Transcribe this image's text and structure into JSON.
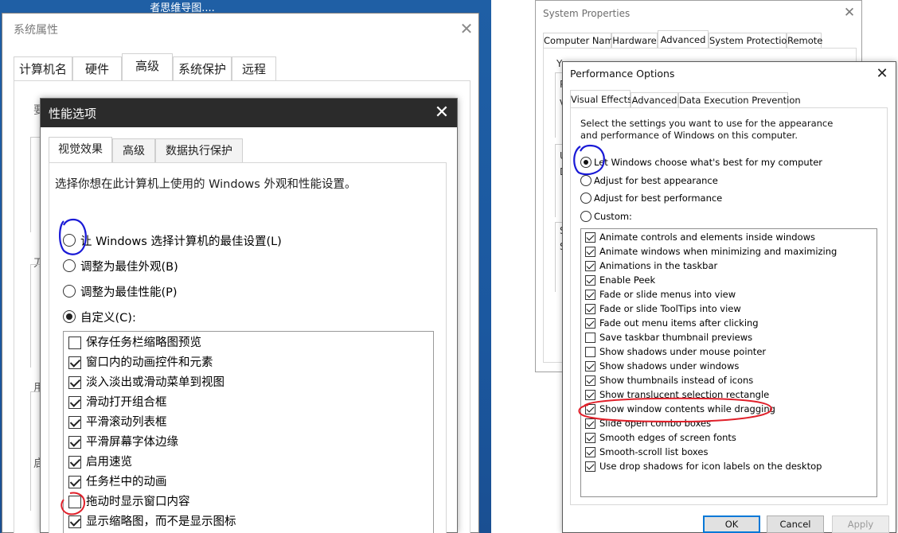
{
  "left": {
    "background_window_title": "者思维导图....",
    "system_properties": {
      "title": "系统属性",
      "tabs": [
        "计算机名",
        "硬件",
        "高级",
        "系统保护",
        "远程"
      ],
      "active_tab": 2,
      "fragments": [
        "要",
        "刀",
        "用",
        "启"
      ]
    },
    "performance_options": {
      "title": "性能选项",
      "tabs": [
        "视觉效果",
        "高级",
        "数据执行保护"
      ],
      "active_tab": 0,
      "description": "选择你想在此计算机上使用的 Windows 外观和性能设置。",
      "radios": [
        {
          "label": "让 Windows 选择计算机的最佳设置(L)",
          "checked": false
        },
        {
          "label": "调整为最佳外观(B)",
          "checked": false
        },
        {
          "label": "调整为最佳性能(P)",
          "checked": false
        },
        {
          "label": "自定义(C):",
          "checked": true
        }
      ],
      "checkbox_items": [
        {
          "label": "保存任务栏缩略图预览",
          "checked": false
        },
        {
          "label": "窗口内的动画控件和元素",
          "checked": true
        },
        {
          "label": "淡入淡出或滑动菜单到视图",
          "checked": true
        },
        {
          "label": "滑动打开组合框",
          "checked": true
        },
        {
          "label": "平滑滚动列表框",
          "checked": true
        },
        {
          "label": "平滑屏幕字体边缘",
          "checked": true
        },
        {
          "label": "启用速览",
          "checked": true
        },
        {
          "label": "任务栏中的动画",
          "checked": true
        },
        {
          "label": "拖动时显示窗口内容",
          "checked": false
        },
        {
          "label": "显示缩略图，而不是显示图标",
          "checked": true
        }
      ]
    }
  },
  "right": {
    "system_properties": {
      "title": "System Properties",
      "tabs": [
        "Computer Name",
        "Hardware",
        "Advanced",
        "System Protection",
        "Remote"
      ],
      "active_tab": 2,
      "fragments": [
        "Y",
        "P",
        "V",
        "U",
        "D",
        "S",
        "S"
      ]
    },
    "performance_options": {
      "title": "Performance Options",
      "tabs": [
        "Visual Effects",
        "Advanced",
        "Data Execution Prevention"
      ],
      "active_tab": 0,
      "description": "Select the settings you want to use for the appearance and performance of Windows on this computer.",
      "radios": [
        {
          "label": "Let Windows choose what's best for my computer",
          "checked": true
        },
        {
          "label": "Adjust for best appearance",
          "checked": false
        },
        {
          "label": "Adjust for best performance",
          "checked": false
        },
        {
          "label": "Custom:",
          "checked": false
        }
      ],
      "checkbox_items": [
        {
          "label": "Animate controls and elements inside windows",
          "checked": true
        },
        {
          "label": "Animate windows when minimizing and maximizing",
          "checked": true
        },
        {
          "label": "Animations in the taskbar",
          "checked": true
        },
        {
          "label": "Enable Peek",
          "checked": true
        },
        {
          "label": "Fade or slide menus into view",
          "checked": true
        },
        {
          "label": "Fade or slide ToolTips into view",
          "checked": true
        },
        {
          "label": "Fade out menu items after clicking",
          "checked": true
        },
        {
          "label": "Save taskbar thumbnail previews",
          "checked": false
        },
        {
          "label": "Show shadows under mouse pointer",
          "checked": false
        },
        {
          "label": "Show shadows under windows",
          "checked": true
        },
        {
          "label": "Show thumbnails instead of icons",
          "checked": true
        },
        {
          "label": "Show translucent selection rectangle",
          "checked": true
        },
        {
          "label": "Show window contents while dragging",
          "checked": true
        },
        {
          "label": "Slide open combo boxes",
          "checked": true
        },
        {
          "label": "Smooth edges of screen fonts",
          "checked": true
        },
        {
          "label": "Smooth-scroll list boxes",
          "checked": true
        },
        {
          "label": "Use drop shadows for icon labels on the desktop",
          "checked": true
        }
      ],
      "buttons": {
        "ok": "OK",
        "cancel": "Cancel",
        "apply": "Apply"
      }
    }
  },
  "annotation_colors": {
    "blue": "#1a1ad6",
    "red": "#e0202a"
  }
}
